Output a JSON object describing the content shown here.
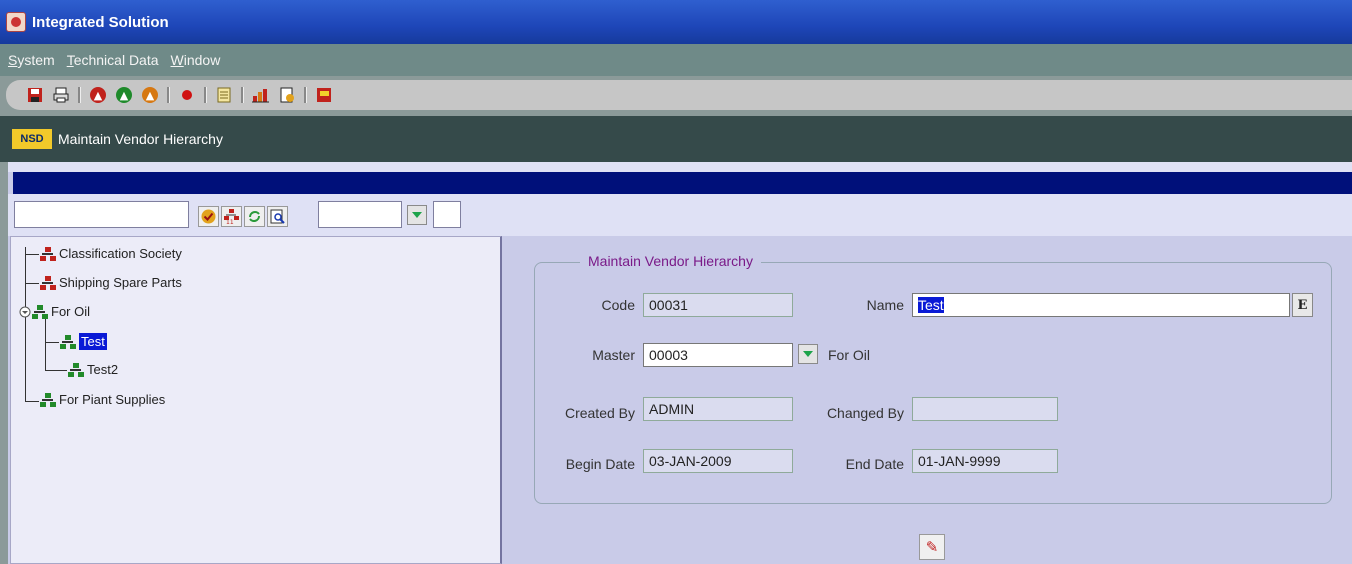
{
  "window": {
    "title": "Integrated Solution"
  },
  "menu": {
    "items": [
      "System",
      "Technical Data",
      "Window"
    ]
  },
  "toolbar": {
    "buttons": [
      "save-icon",
      "print-icon",
      "navigate-up-icon",
      "navigate-next-icon",
      "navigate-top-icon",
      "record-icon",
      "list-icon",
      "chart-icon",
      "document-icon",
      "exit-icon"
    ]
  },
  "form": {
    "logo": "NSD",
    "title": "Maintain Vendor Hierarchy"
  },
  "tree": {
    "nodes": [
      {
        "label": "Classification Society",
        "color": "red"
      },
      {
        "label": "Shipping Spare Parts",
        "color": "red"
      },
      {
        "label": "For Oil",
        "color": "green"
      },
      {
        "label": "Test",
        "color": "green",
        "selected": true
      },
      {
        "label": "Test2",
        "color": "green"
      },
      {
        "label": "For Piant Supplies",
        "color": "green"
      }
    ]
  },
  "details": {
    "group_title": "Maintain Vendor Hierarchy",
    "code": {
      "label": "Code",
      "value": "00031"
    },
    "name": {
      "label": "Name",
      "value": "Test"
    },
    "edit_button": "E",
    "master": {
      "label": "Master",
      "value": "00003",
      "desc": "For Oil"
    },
    "created_by": {
      "label": "Created By",
      "value": "ADMIN"
    },
    "changed_by": {
      "label": "Changed By",
      "value": ""
    },
    "begin_date": {
      "label": "Begin Date",
      "value": "03-JAN-2009"
    },
    "end_date": {
      "label": "End Date",
      "value": "01-JAN-9999"
    }
  },
  "colors": {
    "titlebar": "#1e46b8",
    "selection": "#0a1ad6",
    "accent_bar": "#00107a",
    "group_title": "#7a1a88"
  }
}
